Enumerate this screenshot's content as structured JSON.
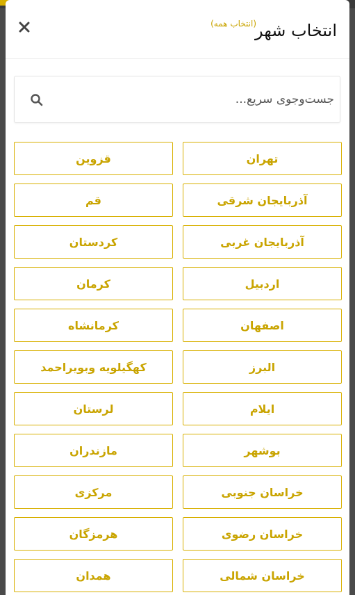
{
  "header": {
    "title": "انتخاب شهر",
    "select_all": "(انتخاب همه)",
    "close_symbol": "✕"
  },
  "search": {
    "placeholder": "جست‌وجوی سریع..."
  },
  "colors": {
    "accent": "#c9a400",
    "border_accent": "#d8b000"
  },
  "cities": [
    {
      "right": "تهران",
      "left": "قزوین"
    },
    {
      "right": "آذربایجان شرقی",
      "left": "قم"
    },
    {
      "right": "آذربایجان غربی",
      "left": "کردستان"
    },
    {
      "right": "اردبیل",
      "left": "کرمان"
    },
    {
      "right": "اصفهان",
      "left": "کرمانشاه"
    },
    {
      "right": "البرز",
      "left": "کهگیلویه وبویراحمد"
    },
    {
      "right": "ایلام",
      "left": "لرستان"
    },
    {
      "right": "بوشهر",
      "left": "مازندران"
    },
    {
      "right": "خراسان جنوبی",
      "left": "مرکزی"
    },
    {
      "right": "خراسان رضوی",
      "left": "هرمزگان"
    },
    {
      "right": "خراسان شمالی",
      "left": "همدان"
    }
  ]
}
